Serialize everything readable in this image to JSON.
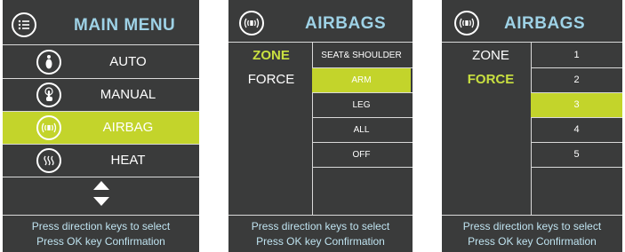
{
  "main_menu": {
    "title": "MAIN MENU",
    "header_icon": "list-icon",
    "items": [
      {
        "label": "AUTO",
        "icon": "auto-person-icon",
        "selected": false
      },
      {
        "label": "MANUAL",
        "icon": "touch-hand-icon",
        "selected": false
      },
      {
        "label": "AIRBAG",
        "icon": "airbag-icon",
        "selected": true
      },
      {
        "label": "HEAT",
        "icon": "heat-icon",
        "selected": false
      }
    ],
    "scroll_icon": "up-down-arrows-icon",
    "footer_line1": "Press direction keys to select",
    "footer_line2": "Press OK key Confirmation"
  },
  "airbags_zone": {
    "title": "AIRBAGS",
    "header_icon": "airbag-icon",
    "left_items": [
      {
        "label": "ZONE",
        "active": true
      },
      {
        "label": "FORCE",
        "active": false
      }
    ],
    "options": [
      {
        "label": "SEAT& SHOULDER",
        "selected": false
      },
      {
        "label": "ARM",
        "selected": true
      },
      {
        "label": "LEG",
        "selected": false
      },
      {
        "label": "ALL",
        "selected": false
      },
      {
        "label": "OFF",
        "selected": false
      }
    ],
    "footer_line1": "Press direction keys to select",
    "footer_line2": "Press OK key Confirmation"
  },
  "airbags_force": {
    "title": "AIRBAGS",
    "header_icon": "airbag-icon",
    "left_items": [
      {
        "label": "ZONE",
        "active": false
      },
      {
        "label": "FORCE",
        "active": true
      }
    ],
    "options": [
      {
        "label": "1",
        "selected": false
      },
      {
        "label": "2",
        "selected": false
      },
      {
        "label": "3",
        "selected": true
      },
      {
        "label": "4",
        "selected": false
      },
      {
        "label": "5",
        "selected": false
      }
    ],
    "footer_line1": "Press direction keys to select",
    "footer_line2": "Press OK key Confirmation"
  },
  "colors": {
    "panel_bg": "#3a3b3b",
    "selected_bg": "#c3d42b",
    "title_text": "#9ed2e6",
    "active_label": "#c9e040",
    "footer_text": "#bfe3f0"
  }
}
